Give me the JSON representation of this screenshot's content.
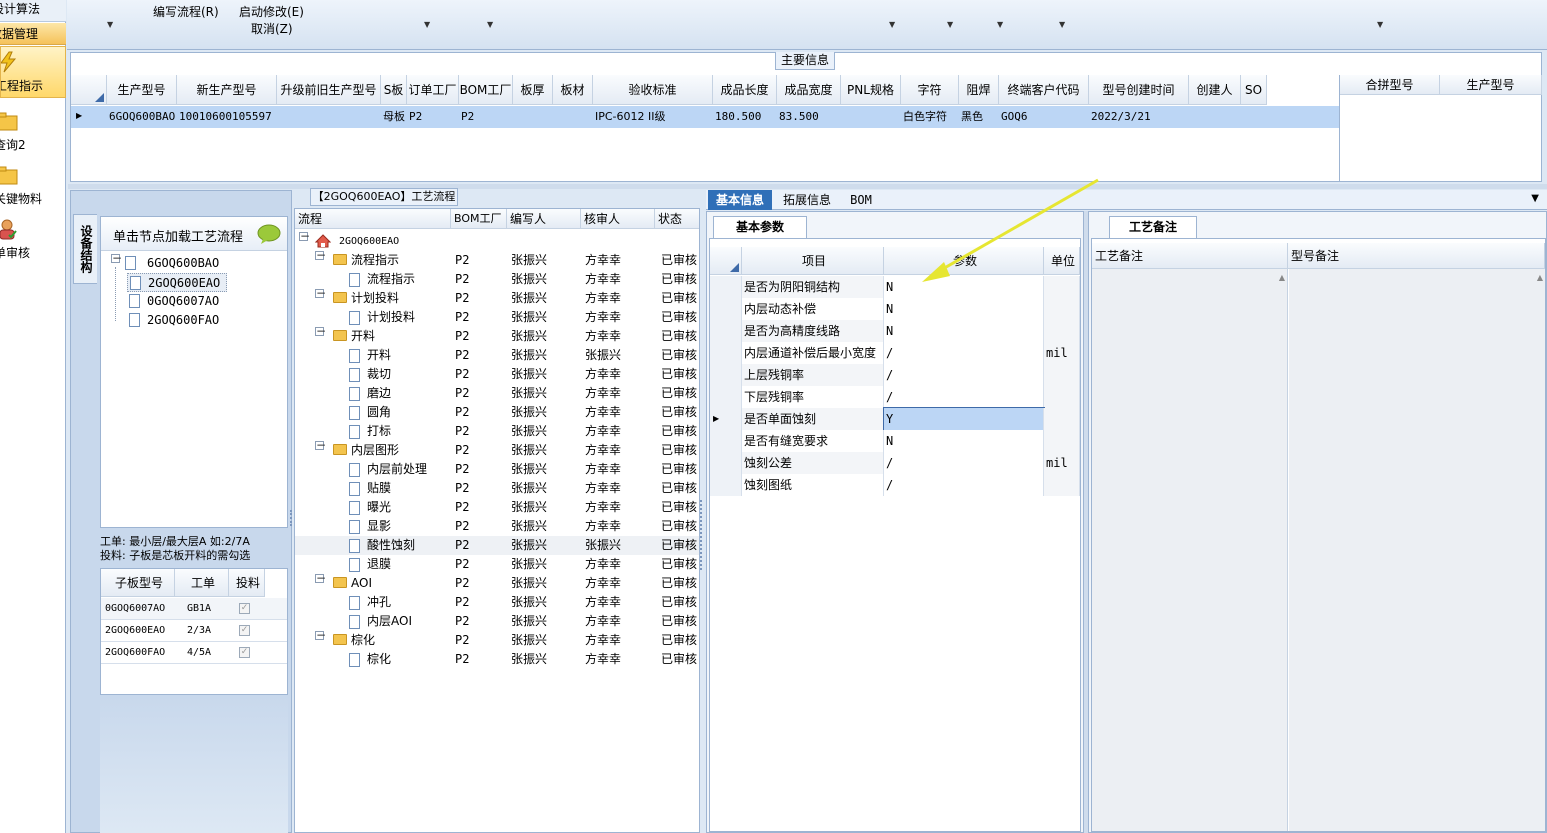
{
  "nav": {
    "top_label": "设计算法",
    "section_label": "数据管理",
    "items": [
      {
        "label": "工程指示",
        "icon": "lightning-icon"
      },
      {
        "label": "查询2",
        "icon": "folder-icon"
      },
      {
        "label": "关键物料",
        "icon": "folder-icon"
      },
      {
        "label": "单审核",
        "icon": "user-check-icon"
      }
    ]
  },
  "toolbar": {
    "edit_flow": "编写流程(R)",
    "start_modify": "启动修改(E)",
    "cancel": "取消(Z)"
  },
  "main_info": {
    "title": "主要信息",
    "columns": [
      "生产型号",
      "新生产型号",
      "升级前旧生产型号",
      "S板",
      "订单工厂",
      "BOM工厂",
      "板厚",
      "板材",
      "验收标准",
      "成品长度",
      "成品宽度",
      "PNL规格",
      "字符",
      "阻焊",
      "终端客户代码",
      "型号创建时间",
      "创建人",
      "SO"
    ],
    "row": [
      "6GOQ600BAO",
      "10010600105597",
      "",
      "母板",
      "P2",
      "P2",
      "",
      "",
      "IPC-6012 II级",
      "180.500",
      "83.500",
      "",
      "白色字符",
      "黑色",
      "GOQ6",
      "2022/3/21",
      "",
      ""
    ],
    "side_columns": [
      "合拼型号",
      "生产型号"
    ]
  },
  "left_panel": {
    "vertical_tab": "设备结构",
    "hint": "单击节点加载工艺流程",
    "tree": [
      {
        "label": "6GOQ600BAO",
        "level": 0
      },
      {
        "label": "2GOQ600EAO",
        "level": 1
      },
      {
        "label": "0GOQ6007AO",
        "level": 1
      },
      {
        "label": "2GOQ600FAO",
        "level": 1
      }
    ],
    "note_line1": "工单: 最小层/最大层A 如:2/7A",
    "note_line2": "投料: 子板是芯板开料的需勾选",
    "sub_columns": [
      "子板型号",
      "工单",
      "投料"
    ],
    "sub_rows": [
      {
        "model": "0GOQ6007AO",
        "order": "GB1A"
      },
      {
        "model": "2GOQ600EAO",
        "order": "2/3A"
      },
      {
        "model": "2GOQ600FAO",
        "order": "4/5A"
      }
    ]
  },
  "flow_panel": {
    "title": "【2GOQ600EAO】工艺流程",
    "columns": [
      "流程",
      "BOM工厂",
      "编写人",
      "核审人",
      "状态"
    ],
    "root": "2GOQ600EAO",
    "rows": [
      {
        "name": "流程指示",
        "type": "folder",
        "bom": "P2",
        "writer": "张振兴",
        "reviewer": "方幸幸",
        "status": "已审核"
      },
      {
        "name": "流程指示",
        "type": "doc",
        "bom": "P2",
        "writer": "张振兴",
        "reviewer": "方幸幸",
        "status": "已审核"
      },
      {
        "name": "计划投料",
        "type": "folder",
        "bom": "P2",
        "writer": "张振兴",
        "reviewer": "方幸幸",
        "status": "已审核"
      },
      {
        "name": "计划投料",
        "type": "doc",
        "bom": "P2",
        "writer": "张振兴",
        "reviewer": "方幸幸",
        "status": "已审核"
      },
      {
        "name": "开料",
        "type": "folder",
        "bom": "P2",
        "writer": "张振兴",
        "reviewer": "方幸幸",
        "status": "已审核"
      },
      {
        "name": "开料",
        "type": "doc",
        "bom": "P2",
        "writer": "张振兴",
        "reviewer": "张振兴",
        "status": "已审核"
      },
      {
        "name": "裁切",
        "type": "doc",
        "bom": "P2",
        "writer": "张振兴",
        "reviewer": "方幸幸",
        "status": "已审核"
      },
      {
        "name": "磨边",
        "type": "doc",
        "bom": "P2",
        "writer": "张振兴",
        "reviewer": "方幸幸",
        "status": "已审核"
      },
      {
        "name": "圆角",
        "type": "doc",
        "bom": "P2",
        "writer": "张振兴",
        "reviewer": "方幸幸",
        "status": "已审核"
      },
      {
        "name": "打标",
        "type": "doc",
        "bom": "P2",
        "writer": "张振兴",
        "reviewer": "方幸幸",
        "status": "已审核"
      },
      {
        "name": "内层图形",
        "type": "folder",
        "bom": "P2",
        "writer": "张振兴",
        "reviewer": "方幸幸",
        "status": "已审核"
      },
      {
        "name": "内层前处理",
        "type": "doc",
        "bom": "P2",
        "writer": "张振兴",
        "reviewer": "方幸幸",
        "status": "已审核"
      },
      {
        "name": "贴膜",
        "type": "doc",
        "bom": "P2",
        "writer": "张振兴",
        "reviewer": "方幸幸",
        "status": "已审核"
      },
      {
        "name": "曝光",
        "type": "doc",
        "bom": "P2",
        "writer": "张振兴",
        "reviewer": "方幸幸",
        "status": "已审核"
      },
      {
        "name": "显影",
        "type": "doc",
        "bom": "P2",
        "writer": "张振兴",
        "reviewer": "方幸幸",
        "status": "已审核"
      },
      {
        "name": "酸性蚀刻",
        "type": "doc",
        "bom": "P2",
        "writer": "张振兴",
        "reviewer": "张振兴",
        "status": "已审核"
      },
      {
        "name": "退膜",
        "type": "doc",
        "bom": "P2",
        "writer": "张振兴",
        "reviewer": "方幸幸",
        "status": "已审核"
      },
      {
        "name": "AOI",
        "type": "folder",
        "bom": "P2",
        "writer": "张振兴",
        "reviewer": "方幸幸",
        "status": "已审核"
      },
      {
        "name": "冲孔",
        "type": "doc",
        "bom": "P2",
        "writer": "张振兴",
        "reviewer": "方幸幸",
        "status": "已审核"
      },
      {
        "name": "内层AOI",
        "type": "doc",
        "bom": "P2",
        "writer": "张振兴",
        "reviewer": "方幸幸",
        "status": "已审核"
      },
      {
        "name": "棕化",
        "type": "folder",
        "bom": "P2",
        "writer": "张振兴",
        "reviewer": "方幸幸",
        "status": "已审核"
      },
      {
        "name": "棕化",
        "type": "doc",
        "bom": "P2",
        "writer": "张振兴",
        "reviewer": "方幸幸",
        "status": "已审核"
      }
    ]
  },
  "right_panel": {
    "tabs": [
      "基本信息",
      "拓展信息",
      "BOM"
    ],
    "sub_tab": "基本参数",
    "columns": [
      "项目",
      "参数",
      "单位"
    ],
    "params": [
      {
        "item": "是否为阴阳铜结构",
        "value": "N",
        "unit": ""
      },
      {
        "item": "内层动态补偿",
        "value": "N",
        "unit": ""
      },
      {
        "item": "是否为高精度线路",
        "value": "N",
        "unit": ""
      },
      {
        "item": "内层通道补偿后最小宽度",
        "value": "/",
        "unit": "mil"
      },
      {
        "item": "上层残铜率",
        "value": "/",
        "unit": ""
      },
      {
        "item": "下层残铜率",
        "value": "/",
        "unit": ""
      },
      {
        "item": "是否单面蚀刻",
        "value": "Y",
        "unit": ""
      },
      {
        "item": "是否有缝宽要求",
        "value": "N",
        "unit": ""
      },
      {
        "item": "蚀刻公差",
        "value": "/",
        "unit": "mil"
      },
      {
        "item": "蚀刻图纸",
        "value": "/",
        "unit": ""
      }
    ],
    "notes_tab": "工艺备注",
    "notes_columns": [
      "工艺备注",
      "型号备注"
    ]
  },
  "colors": {
    "accent": "#2f6fb8",
    "selection": "#bcd6f5",
    "annotation_arrow": "#e6e632"
  }
}
